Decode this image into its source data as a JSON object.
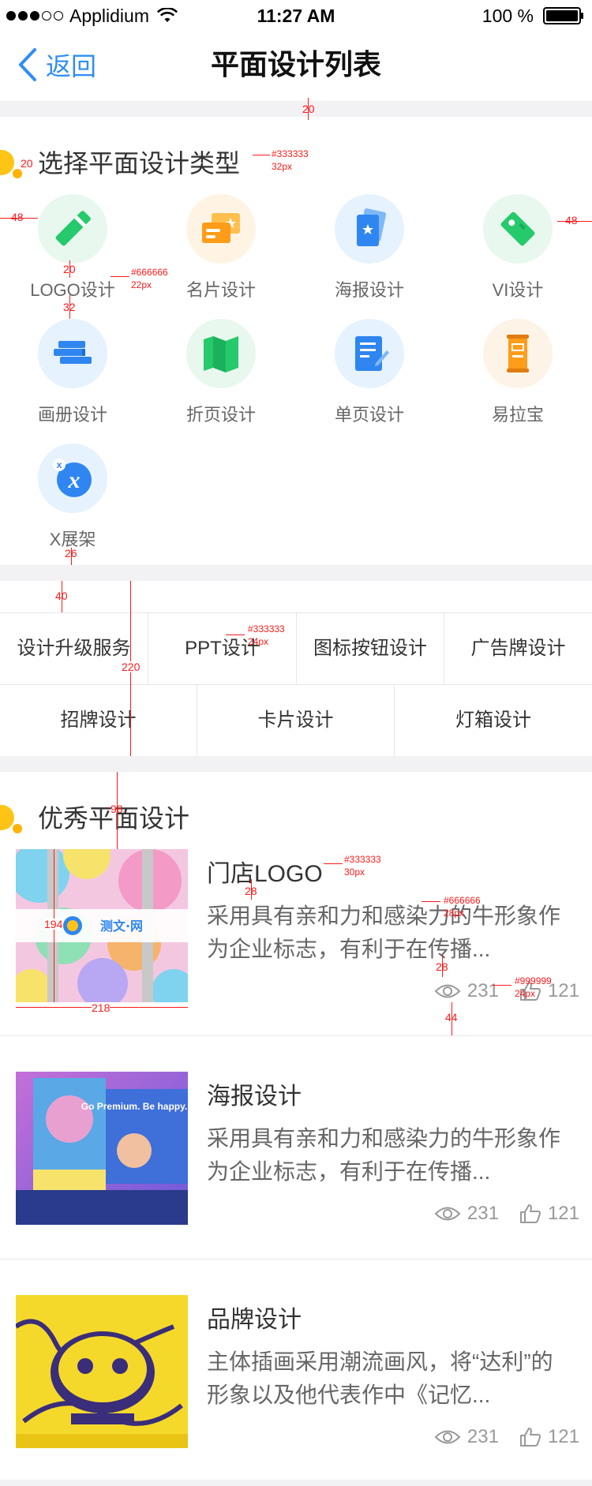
{
  "status_bar": {
    "carrier": "Applidium",
    "time": "11:27 AM",
    "battery": "100 %"
  },
  "nav": {
    "back_label": "返回",
    "title": "平面设计列表"
  },
  "section_types": {
    "title": "选择平面设计类型",
    "items": [
      {
        "label": "LOGO设计",
        "icon": "marker-icon",
        "bg": "#e8f8ee",
        "color": "#26c96b"
      },
      {
        "label": "名片设计",
        "icon": "business-card-icon",
        "bg": "#fff4e4",
        "color": "#ff9c1a"
      },
      {
        "label": "海报设计",
        "icon": "poster-icon",
        "bg": "#e6f2fd",
        "color": "#2f86f0"
      },
      {
        "label": "VI设计",
        "icon": "vi-tag-icon",
        "bg": "#e8f8ee",
        "color": "#26c96b"
      },
      {
        "label": "画册设计",
        "icon": "album-books-icon",
        "bg": "#e6f2fd",
        "color": "#2f86f0"
      },
      {
        "label": "折页设计",
        "icon": "folded-map-icon",
        "bg": "#e8f8ee",
        "color": "#26c96b"
      },
      {
        "label": "单页设计",
        "icon": "single-page-icon",
        "bg": "#e6f2fd",
        "color": "#2f86f0"
      },
      {
        "label": "易拉宝",
        "icon": "rollup-banner-icon",
        "bg": "#fff4e4",
        "color": "#ff9c1a"
      },
      {
        "label": "X展架",
        "icon": "x-stand-icon",
        "bg": "#e6f2fd",
        "color": "#2f86f0"
      }
    ]
  },
  "services": {
    "row1": [
      "设计升级服务",
      "PPT设计",
      "图标按钮设计",
      "广告牌设计"
    ],
    "row2": [
      "招牌设计",
      "卡片设计",
      "灯箱设计"
    ]
  },
  "section_featured": {
    "title": "优秀平面设计",
    "articles": [
      {
        "title": "门店LOGO",
        "description": "采用具有亲和力和感染力的牛形象作为企业标志，有利于在传播...",
        "views": "231",
        "likes": "121",
        "thumb_text": "测文·网"
      },
      {
        "title": "海报设计",
        "description": "采用具有亲和力和感染力的牛形象作为企业标志，有利于在传播...",
        "views": "231",
        "likes": "121",
        "thumb_text": "Go Premium. Be happy."
      },
      {
        "title": "品牌设计",
        "description": "主体插画采用潮流画风，将“达利”的形象以及他代表作中《记忆...",
        "views": "231",
        "likes": "121",
        "thumb_text": ""
      }
    ]
  },
  "annotations": {
    "top_gap": "20",
    "dot_gap": "20",
    "side_margin_left": "48",
    "side_margin_right": "48",
    "title_color": "#333333",
    "title_size": "32px",
    "icon_label_gap": "20",
    "icon_label_color": "#666666",
    "icon_label_size": "22px",
    "row_gap": "32",
    "bottom_gap": "26",
    "services_top": "40",
    "services_color": "#333333",
    "services_size": "24px",
    "services_height": "220",
    "featured_gap": "98",
    "article_title_color": "#333333",
    "article_title_size": "30px",
    "title_desc_gap": "28",
    "desc_color": "#666666",
    "desc_size": "28px",
    "desc_meta_gap": "28",
    "meta_color": "#999999",
    "meta_size": "24px",
    "thumb_height": "194",
    "thumb_width": "218",
    "bottom_pad": "44"
  }
}
